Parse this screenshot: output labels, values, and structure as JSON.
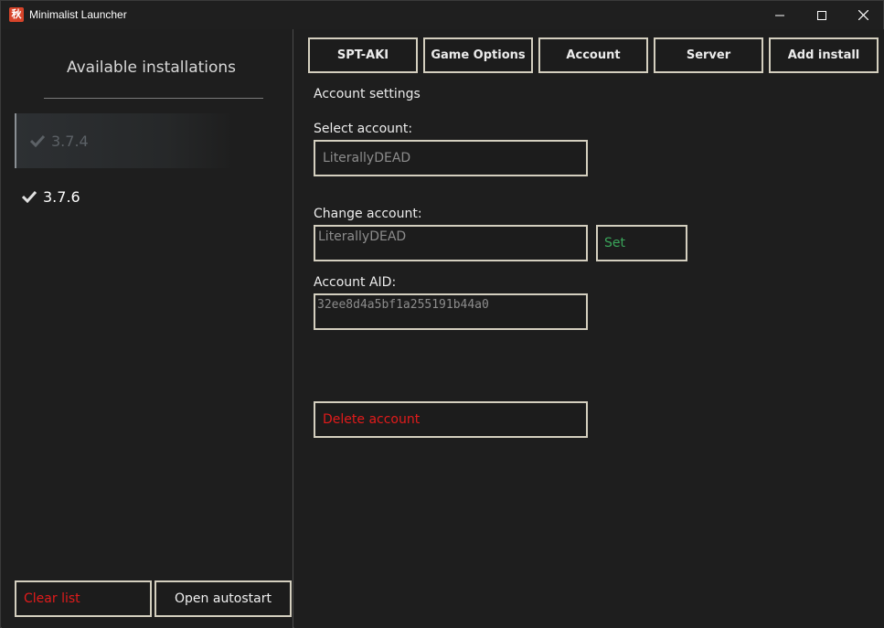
{
  "window": {
    "title": "Minimalist Launcher",
    "icon_glyph": "秋"
  },
  "sidebar": {
    "title": "Available installations",
    "installs": [
      {
        "version": "3.7.4",
        "state": "selected"
      },
      {
        "version": "3.7.6",
        "state": "normal"
      }
    ],
    "clear_label": "Clear list",
    "autostart_label": "Open autostart"
  },
  "tabs": [
    {
      "label": "SPT-AKI"
    },
    {
      "label": "Game Options"
    },
    {
      "label": "Account"
    },
    {
      "label": "Server"
    },
    {
      "label": "Add install"
    }
  ],
  "account": {
    "section_title": "Account settings",
    "select_label": "Select account:",
    "select_value": "LiterallyDEAD",
    "change_label": "Change account:",
    "change_value": "LiterallyDEAD",
    "set_label": "Set",
    "aid_label": "Account AID:",
    "aid_value": "32ee8d4a5bf1a255191b44a0",
    "delete_label": "Delete account"
  },
  "colors": {
    "danger": "#e21b1b",
    "success": "#3aa55a",
    "border": "#d4cfbf",
    "background": "#1e1e1e"
  }
}
